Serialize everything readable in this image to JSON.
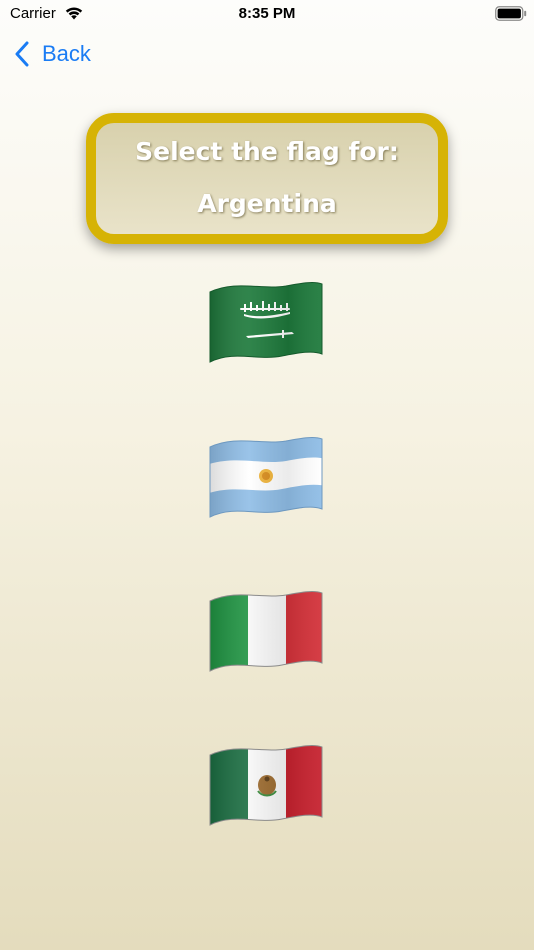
{
  "status_bar": {
    "carrier": "Carrier",
    "time": "8:35 PM",
    "icons": [
      "wifi-icon",
      "battery-icon"
    ]
  },
  "nav": {
    "back_label": "Back",
    "back_icon": "chevron-left-icon",
    "accent_color": "#1a7cf4"
  },
  "prompt": {
    "title": "Select the flag for:",
    "country": "Argentina",
    "border_color": "#d6b305"
  },
  "flag_options": [
    {
      "flag": "saudi-arabia-flag"
    },
    {
      "flag": "argentina-flag"
    },
    {
      "flag": "italy-flag"
    },
    {
      "flag": "mexico-flag"
    }
  ]
}
